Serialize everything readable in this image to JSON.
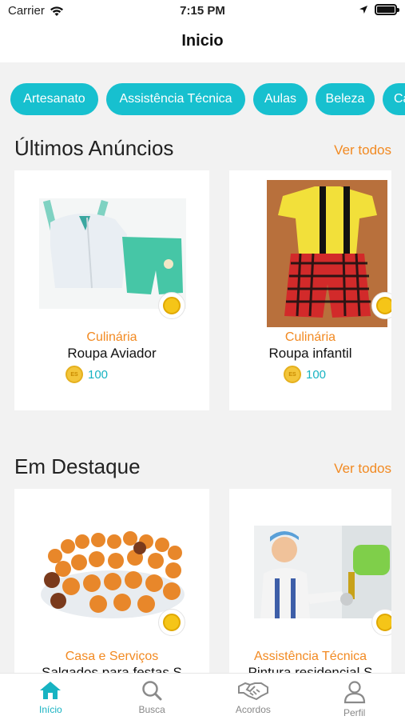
{
  "status_bar": {
    "carrier": "Carrier",
    "time": "7:15 PM"
  },
  "header": {
    "title": "Inicio"
  },
  "categories": [
    "Artesanato",
    "Assistência Técnica",
    "Aulas",
    "Beleza",
    "Ca"
  ],
  "sections": [
    {
      "title": "Últimos Anúncios",
      "see_all": "Ver todos",
      "items": [
        {
          "category": "Culinária",
          "name": "Roupa Aviador",
          "price": "100",
          "coin_label": "ES"
        },
        {
          "category": "Culinária",
          "name": "Roupa infantil",
          "price": "100",
          "coin_label": "ES"
        }
      ]
    },
    {
      "title": "Em Destaque",
      "see_all": "Ver todos",
      "items": [
        {
          "category": "Casa e Serviços",
          "name": "Salgados para festas S"
        },
        {
          "category": "Assistência Técnica",
          "name": "Pintura residencial S"
        }
      ]
    }
  ],
  "tabs": [
    {
      "label": "Início",
      "icon": "home-icon",
      "active": true
    },
    {
      "label": "Busca",
      "icon": "search-icon",
      "active": false
    },
    {
      "label": "Acordos",
      "icon": "handshake-icon",
      "active": false
    },
    {
      "label": "Perfil",
      "icon": "user-icon",
      "active": false
    }
  ],
  "colors": {
    "accent": "#17c0cf",
    "orange": "#f28a22",
    "background": "#f2f2f2"
  }
}
